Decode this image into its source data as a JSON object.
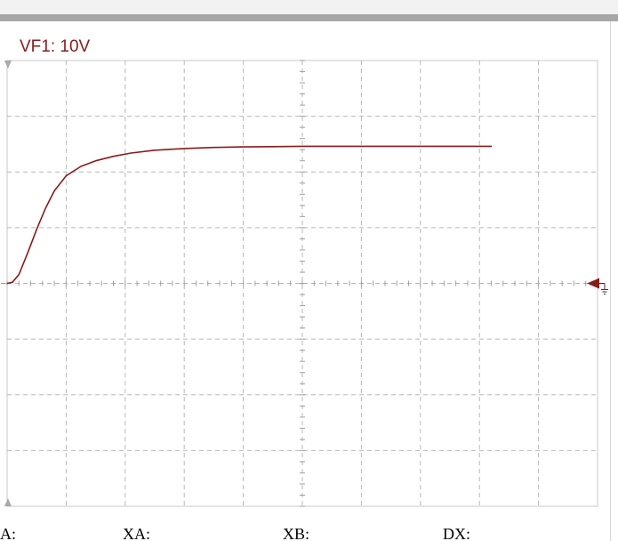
{
  "channel": {
    "label": "VF1: 10V",
    "trace_color": "#8b1a1a"
  },
  "markers": {
    "top_marker": "top-position-marker",
    "bottom_marker": "bottom-position-marker",
    "ground_marker": "ground-reference-icon"
  },
  "readouts": {
    "a_label": "A:",
    "xa_label": "XA:",
    "xb_label": "XB:",
    "dx_label": "DX:"
  },
  "chart_data": {
    "type": "line",
    "series": [
      {
        "color": "#8b1a1a",
        "values": [
          [
            0,
            0.0
          ],
          [
            0.09,
            0.02
          ],
          [
            0.2,
            0.16
          ],
          [
            0.35,
            0.55
          ],
          [
            0.5,
            0.97
          ],
          [
            0.65,
            1.35
          ],
          [
            0.8,
            1.66
          ],
          [
            1.0,
            1.93
          ],
          [
            1.25,
            2.1
          ],
          [
            1.5,
            2.2
          ],
          [
            1.8,
            2.28
          ],
          [
            2.1,
            2.34
          ],
          [
            2.5,
            2.39
          ],
          [
            3.0,
            2.42
          ],
          [
            3.5,
            2.44
          ],
          [
            4.0,
            2.45
          ],
          [
            4.5,
            2.455
          ],
          [
            5.0,
            2.46
          ],
          [
            6.0,
            2.46
          ],
          [
            7.0,
            2.46
          ],
          [
            8.21,
            2.46
          ]
        ]
      }
    ],
    "xlim": [
      0,
      10
    ],
    "ylim": [
      -4,
      4
    ],
    "divisions_x": 10,
    "divisions_y": 8,
    "grid": true
  }
}
